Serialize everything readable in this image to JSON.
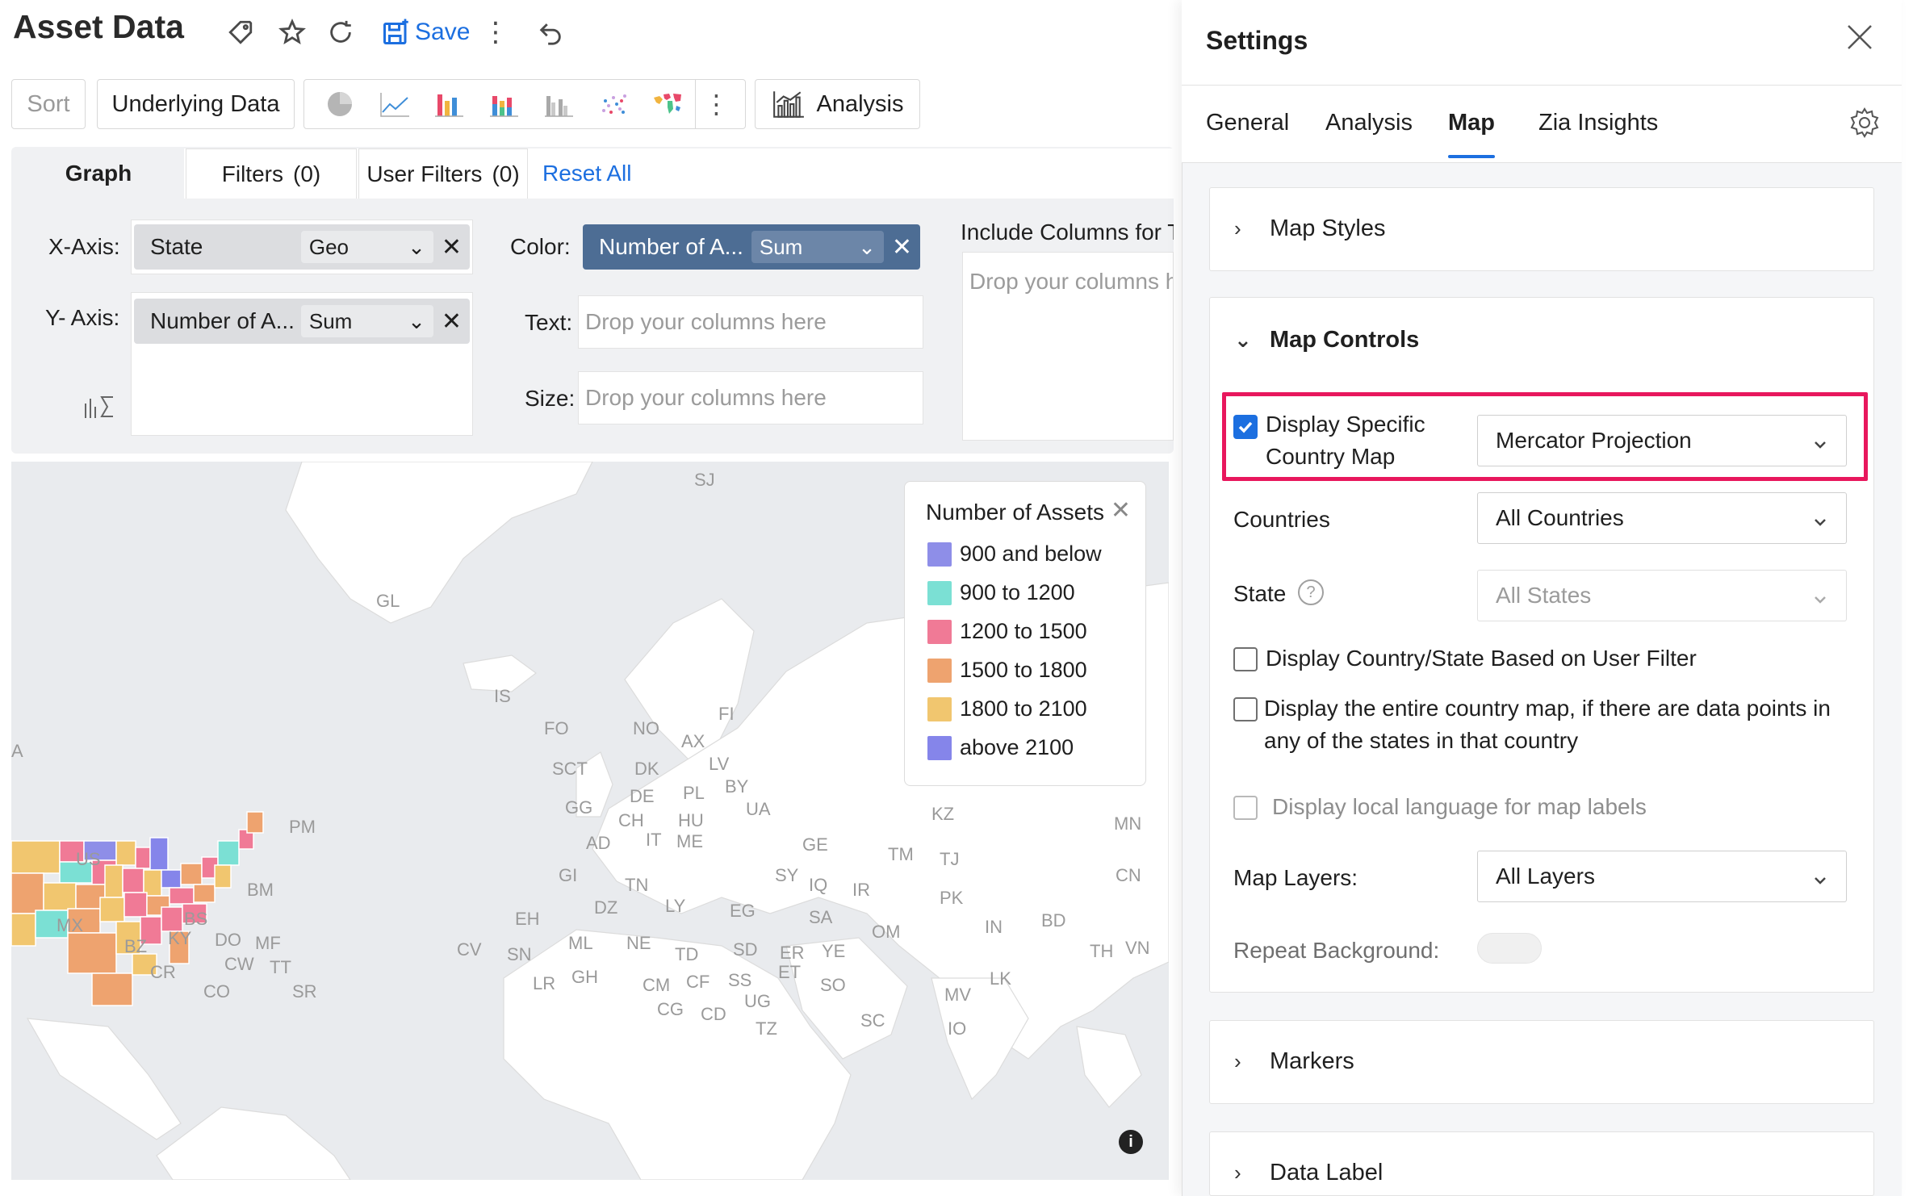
{
  "header": {
    "title": "Asset Data",
    "save_label": "Save"
  },
  "toolbar": {
    "sort_label": "Sort",
    "underlying_label": "Underlying Data",
    "analysis_label": "Analysis",
    "chart_icons": [
      "pie-chart-icon",
      "line-chart-icon",
      "bar-chart-icon",
      "stacked-bar-icon",
      "grouped-bar-icon",
      "scatter-chart-icon",
      "geo-map-icon"
    ]
  },
  "shelf": {
    "tabs": {
      "graph": "Graph",
      "filters": "Filters",
      "filters_count": "(0)",
      "user_filters": "User Filters",
      "user_filters_count": "(0)",
      "reset_all": "Reset All"
    },
    "x_axis_label": "X-Axis:",
    "x_axis_field": "State",
    "x_axis_agg": "Geo",
    "y_axis_label": "Y- Axis:",
    "y_axis_field": "Number of A...",
    "y_axis_agg": "Sum",
    "color_label": "Color:",
    "color_field": "Number of A...",
    "color_agg": "Sum",
    "text_label": "Text:",
    "size_label": "Size:",
    "drop_placeholder": "Drop your columns here",
    "include_label": "Include Columns for To",
    "include_placeholder": "Drop your columns he"
  },
  "map": {
    "labels": [
      "SJ",
      "GL",
      "IS",
      "FO",
      "NO",
      "FI",
      "AX",
      "SCT",
      "DK",
      "LV",
      "DE",
      "PL",
      "BY",
      "GG",
      "UA",
      "CH",
      "HU",
      "AD",
      "IT",
      "ME",
      "KZ",
      "MN",
      "GE",
      "TM",
      "TJ",
      "GI",
      "TN",
      "SY",
      "IQ",
      "IR",
      "CN",
      "PK",
      "DZ",
      "LY",
      "EG",
      "SA",
      "EH",
      "IN",
      "BD",
      "OM",
      "ML",
      "NE",
      "SD",
      "ER",
      "YE",
      "TD",
      "CV",
      "SN",
      "TH",
      "VN",
      "GH",
      "CM",
      "CF",
      "SS",
      "ET",
      "SO",
      "LR",
      "LK",
      "CG",
      "CD",
      "UG",
      "MV",
      "TZ",
      "SC",
      "IO",
      "A",
      "PM",
      "US",
      "BM",
      "MX",
      "BS",
      "BZ",
      "KY",
      "DO",
      "MF",
      "CW",
      "TT",
      "CR",
      "CO",
      "SR"
    ],
    "legend": {
      "title": "Number of Assets",
      "items": [
        {
          "label": "900 and below",
          "color": "#8e8ee8"
        },
        {
          "label": "900 to 1200",
          "color": "#7be0d4"
        },
        {
          "label": "1200 to 1500",
          "color": "#f07a96"
        },
        {
          "label": "1500 to 1800",
          "color": "#eea36f"
        },
        {
          "label": "1800 to 2100",
          "color": "#f1c66f"
        },
        {
          "label": "above 2100",
          "color": "#8585ea"
        }
      ]
    }
  },
  "settings": {
    "title": "Settings",
    "tabs": [
      "General",
      "Analysis",
      "Map",
      "Zia Insights"
    ],
    "active_tab": "Map",
    "sections": {
      "map_styles": "Map Styles",
      "map_controls": "Map Controls",
      "markers": "Markers",
      "data_label": "Data Label"
    },
    "display_specific_line1": "Display Specific",
    "display_specific_line2": "Country Map",
    "display_specific_checked": true,
    "projection_value": "Mercator Projection",
    "countries_label": "Countries",
    "countries_value": "All Countries",
    "state_label": "State",
    "state_value": "All States",
    "opt_user_filter": "Display Country/State Based on User Filter",
    "opt_entire_line1": "Display the entire country map, if there are data points in",
    "opt_entire_line2": "any of the states in that country",
    "opt_local_lang": "Display local language for map labels",
    "map_layers_label": "Map Layers:",
    "map_layers_value": "All Layers",
    "repeat_bg_label": "Repeat Background:",
    "repeat_bg_on": false
  }
}
